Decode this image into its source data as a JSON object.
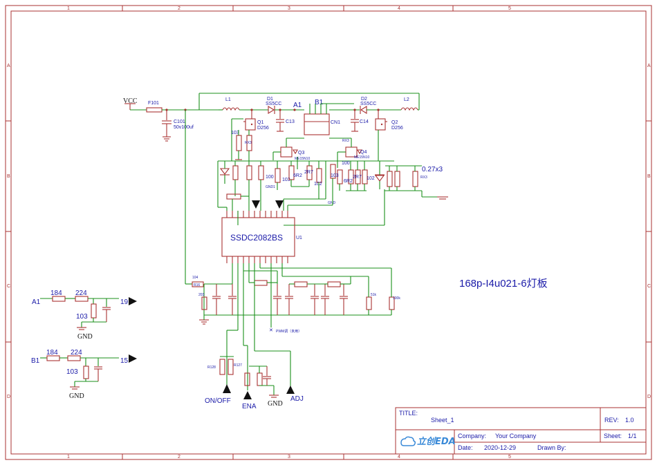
{
  "sheet": {
    "col_labels": [
      "1",
      "2",
      "3",
      "4",
      "5"
    ],
    "row_labels": [
      "A",
      "B",
      "C",
      "D"
    ]
  },
  "board_title": "168p-I4u021-6灯板",
  "ic": {
    "name": "SSDC2082BS",
    "ref": "U1"
  },
  "power": {
    "vcc": "VCC",
    "gnd": "GND"
  },
  "nets": {
    "a1": "A1",
    "b1": "B1",
    "pin19": "19",
    "pin15": "15",
    "on_off": "ON/OFF",
    "ena": "ENA",
    "adj": "ADJ"
  },
  "components": {
    "f101": "F101",
    "c101": "C101",
    "c101_val": "50v100uf",
    "l1": "L1",
    "l2": "L2",
    "d1": "D1",
    "d1_val": "SS5CC",
    "d2": "D2",
    "d2_val": "SS5CC",
    "q1": "Q1",
    "q1_val": "D256",
    "q2": "Q2",
    "q2_val": "D256",
    "q3": "Q3",
    "q3_val": "ME15N10",
    "q4": "Q4",
    "q4_val": "ME15N10",
    "c13": "C13",
    "c14": "C14",
    "cn1": "CN1",
    "r103_a": "103",
    "rx3": "RX3",
    "rx3_top": "RX3",
    "sense_val": "0.27x3",
    "r100_a": "100",
    "r100_b": "100",
    "r103_b": "103",
    "r103_c": "103",
    "r6r2_a": "6R2",
    "r6r2_b": "6R2",
    "r2r7_a": "2R7",
    "r2r7_b": "2R7",
    "r102_a": "102",
    "r102_b": "102",
    "r104": "104",
    "r16": "R16",
    "r203": "203",
    "r51k": "51k",
    "r100k": "100k",
    "pwm_note": "PWM调（未用）",
    "r128": "R128",
    "r127": "R127",
    "gnd_small": "GND",
    "gnd1": "GND1"
  },
  "filter_a": {
    "r1": "184",
    "r2": "224",
    "c": "103",
    "gnd": "GND"
  },
  "filter_b": {
    "r1": "184",
    "r2": "224",
    "c": "103",
    "gnd": "GND"
  },
  "title_block": {
    "title_label": "TITLE:",
    "title_value": "Sheet_1",
    "rev_label": "REV:",
    "rev_value": "1.0",
    "company_label": "Company:",
    "company_value": "Your Company",
    "sheet_label": "Sheet:",
    "sheet_value": "1/1",
    "date_label": "Date:",
    "date_value": "2020-12-29",
    "drawn_label": "Drawn By:",
    "logo_text": "立创EDA"
  }
}
